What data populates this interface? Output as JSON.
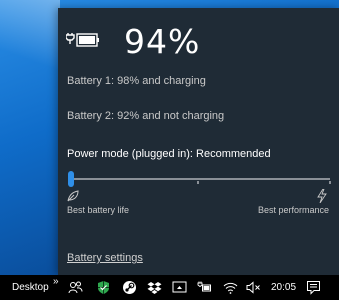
{
  "flyout": {
    "percent": "94%",
    "battery1": "Battery 1: 98% and charging",
    "battery2": "Battery 2: 92% and not charging",
    "mode_title": "Power mode (plugged in): Recommended",
    "slider_value": 0,
    "slider_left_label": "Best battery life",
    "slider_right_label": "Best performance",
    "settings_link": "Battery settings"
  },
  "taskbar": {
    "desktop_label": "Desktop",
    "chevron": "»",
    "icons": [
      "people-icon",
      "defender-icon",
      "steam-icon",
      "dropbox-icon",
      "display-icon",
      "battery-icon",
      "wifi-icon",
      "volume-muted-icon"
    ],
    "time": "20:05"
  },
  "colors": {
    "flyout_bg": "#1f2b36",
    "accent": "#2f8fe8"
  }
}
